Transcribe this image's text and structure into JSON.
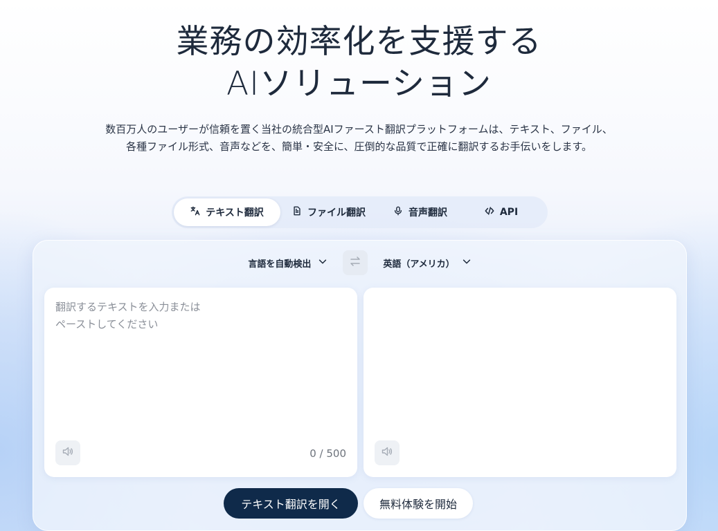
{
  "hero": {
    "title_line1": "業務の効率化を支援する",
    "title_line2": "AIソリューション",
    "description_line1": "数百万人のユーザーが信頼を置く当社の統合型AIファースト翻訳プラットフォームは、テキスト、ファイル、",
    "description_line2": "各種ファイル形式、音声などを、簡単・安全に、圧倒的な品質で正確に翻訳するお手伝いをします。"
  },
  "tabs": [
    {
      "label": "テキスト翻訳",
      "icon": "translate-icon",
      "active": true
    },
    {
      "label": "ファイル翻訳",
      "icon": "document-icon",
      "active": false
    },
    {
      "label": "音声翻訳",
      "icon": "microphone-icon",
      "active": false
    },
    {
      "label": "API",
      "icon": "code-icon",
      "active": false
    }
  ],
  "translator": {
    "source_language": "言語を自動検出",
    "target_language": "英語（アメリカ）",
    "swap_icon": "swap-arrows-icon",
    "source_placeholder": "翻訳するテキストを入力または\nペーストしてください",
    "source_value": "",
    "char_counter": "0 / 500",
    "target_text": "",
    "speaker_icon": "speaker-icon"
  },
  "actions": {
    "open_text_translation": "テキスト翻訳を開く",
    "start_free_trial": "無料体験を開始"
  },
  "colors": {
    "primary_button": "#0f2a4a",
    "title_text": "#1e2a3c",
    "panel_background": "#f0f5fd"
  }
}
